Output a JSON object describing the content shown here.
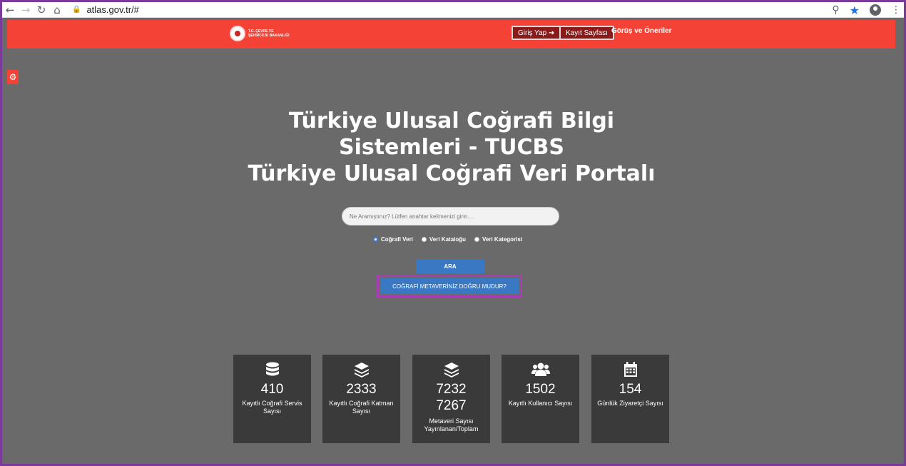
{
  "browser": {
    "url": "atlas.gov.tr/#"
  },
  "header": {
    "logo_text": "T.C. ÇEVRE VE ŞEHİRCİLİK BAKANLIĞI",
    "login_label": "Giriş Yap ➜",
    "register_label": "Kayıt Sayfası",
    "feedback_label": "Görüş ve Öneriler"
  },
  "hero": {
    "title_line1": "Türkiye Ulusal Coğrafi Bilgi",
    "title_line2": "Sistemleri - TUCBS",
    "title_line3": "Türkiye Ulusal Coğrafi Veri Portalı"
  },
  "search": {
    "placeholder": "Ne Aramıştınız? Lütfen anahtar kelimenizi girin....",
    "options": [
      {
        "label": "Coğrafi Veri",
        "selected": true
      },
      {
        "label": "Veri Kataloğu",
        "selected": false
      },
      {
        "label": "Veri Kategorisi",
        "selected": false
      }
    ],
    "button_label": "ARA",
    "meta_button_label": "COĞRAFİ METAVERİNİZ DOĞRU MUDUR?"
  },
  "stats": [
    {
      "icon": "database-icon",
      "value": "410",
      "label": "Kayıtlı Coğrafi Servis Sayısı"
    },
    {
      "icon": "layers-icon",
      "value": "2333",
      "label": "Kayıtlı Coğrafi Katman Sayısı"
    },
    {
      "icon": "layers-icon",
      "value": "7232",
      "value2": "7267",
      "label": "Metaveri Sayısı Yayınlanan/Toplam"
    },
    {
      "icon": "users-icon",
      "value": "1502",
      "label": "Kayıtlı Kullanıcı Sayısı"
    },
    {
      "icon": "calendar-icon",
      "value": "154",
      "label": "Günlük Ziyaretçi Sayısı"
    }
  ],
  "colors": {
    "header_red": "#f44336",
    "page_gray": "#6a6a6a",
    "card_dark": "#3a3a3a",
    "button_blue": "#3a78c3",
    "highlight_purple": "#a83db5"
  }
}
